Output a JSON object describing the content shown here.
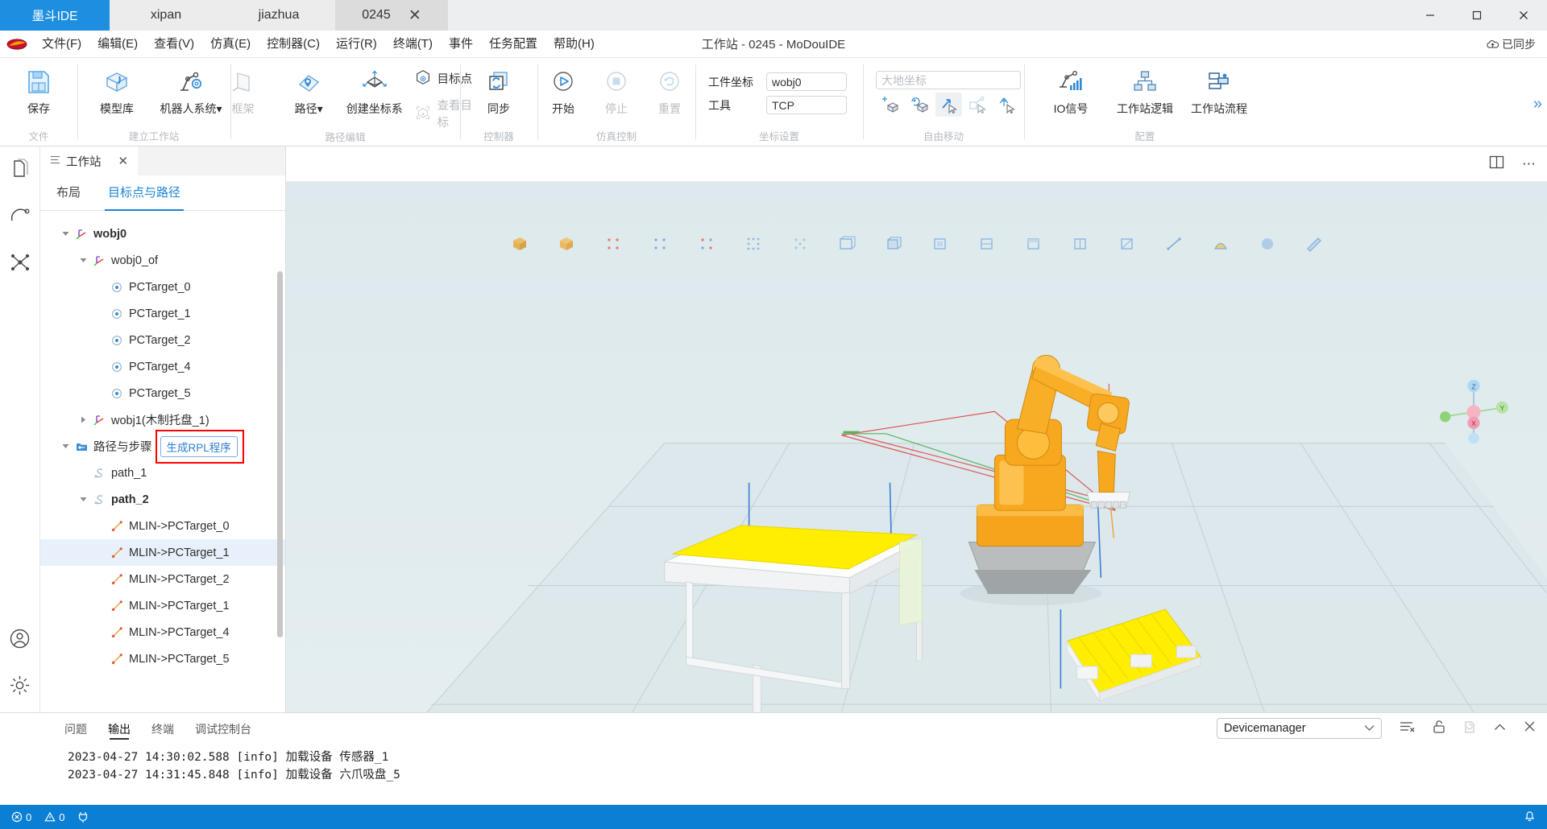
{
  "window": {
    "title": "工作站 - 0245 - MoDouIDE",
    "sync_label": "已同步",
    "minimize": "—",
    "maximize": "▢",
    "close": "✕"
  },
  "tabs": [
    {
      "label": "墨斗IDE",
      "type": "brand"
    },
    {
      "label": "xipan",
      "type": "plain"
    },
    {
      "label": "jiazhua",
      "type": "plain"
    },
    {
      "label": "0245",
      "type": "current",
      "close": "✕"
    }
  ],
  "menu": [
    "文件(F)",
    "编辑(E)",
    "查看(V)",
    "仿真(E)",
    "控制器(C)",
    "运行(R)",
    "终端(T)",
    "事件",
    "任务配置",
    "帮助(H)"
  ],
  "ribbon": {
    "expander": "»",
    "groups": [
      {
        "name": "文件",
        "buttons": [
          {
            "label": "保存",
            "icon": "save-icon",
            "disabled": false
          }
        ]
      },
      {
        "name": "建立工作站",
        "buttons": [
          {
            "label": "模型库",
            "icon": "model-library-icon",
            "disabled": false
          },
          {
            "label": "机器人系统▾",
            "icon": "robot-system-icon",
            "disabled": false
          }
        ]
      },
      {
        "name": "路径编辑",
        "buttons": [
          {
            "label": "框架",
            "icon": "frame-icon",
            "disabled": true
          },
          {
            "label": "路径▾",
            "icon": "path-icon",
            "disabled": false
          },
          {
            "label": "创建坐标系",
            "icon": "create-coordinate-icon",
            "disabled": false
          }
        ],
        "small_buttons": [
          {
            "label": "目标点",
            "icon": "target-point-icon",
            "disabled": false
          },
          {
            "label": "查看目标",
            "icon": "view-target-icon",
            "disabled": true
          }
        ]
      },
      {
        "name": "控制器",
        "buttons": [
          {
            "label": "同步",
            "icon": "sync-icon",
            "disabled": false
          }
        ]
      },
      {
        "name": "仿真控制",
        "buttons": [
          {
            "label": "开始",
            "icon": "play-icon",
            "disabled": false
          },
          {
            "label": "停止",
            "icon": "stop-icon",
            "disabled": true
          },
          {
            "label": "重置",
            "icon": "reset-icon",
            "disabled": true
          }
        ]
      },
      {
        "name": "坐标设置",
        "fields": [
          {
            "label": "工件坐标",
            "value": "wobj0"
          },
          {
            "label": "工具",
            "value": "TCP"
          }
        ]
      },
      {
        "name": "自由移动",
        "coord_placeholder": "大地坐标",
        "move_buttons": [
          {
            "icon": "translate-icon",
            "selected": false
          },
          {
            "icon": "rotate-icon",
            "selected": false
          },
          {
            "icon": "freemove-icon",
            "selected": true
          },
          {
            "icon": "align-icon",
            "selected": false
          },
          {
            "icon": "jog-icon",
            "selected": false
          }
        ]
      },
      {
        "name": "配置",
        "buttons": [
          {
            "label": "IO信号",
            "icon": "io-signal-icon",
            "disabled": false
          },
          {
            "label": "工作站逻辑",
            "icon": "station-logic-icon",
            "disabled": false
          },
          {
            "label": "工作站流程",
            "icon": "station-flow-icon",
            "disabled": false
          }
        ]
      }
    ]
  },
  "activity_bar": [
    {
      "icon": "files-icon",
      "name": "explorer"
    },
    {
      "icon": "robot-arc-icon",
      "name": "robot"
    },
    {
      "icon": "nodes-icon",
      "name": "nodes"
    },
    {
      "icon": "account-icon",
      "name": "account"
    },
    {
      "icon": "gear-icon",
      "name": "settings"
    }
  ],
  "left_panel": {
    "tab_label": "工作站",
    "tab_close": "✕",
    "subtabs": [
      {
        "label": "布局",
        "active": false
      },
      {
        "label": "目标点与路径",
        "active": true
      }
    ],
    "rpl_button": "生成RPL程序",
    "tree": [
      {
        "label": "wobj0",
        "indent": 1,
        "caret": "down",
        "icon": "coordinate-frame-icon",
        "bold": true
      },
      {
        "label": "wobj0_of",
        "indent": 2,
        "caret": "down",
        "icon": "coordinate-frame-icon",
        "bold": false
      },
      {
        "label": "PCTarget_0",
        "indent": 3,
        "caret": "none",
        "icon": "target-dot-icon",
        "bold": false
      },
      {
        "label": "PCTarget_1",
        "indent": 3,
        "caret": "none",
        "icon": "target-dot-icon",
        "bold": false
      },
      {
        "label": "PCTarget_2",
        "indent": 3,
        "caret": "none",
        "icon": "target-dot-icon",
        "bold": false
      },
      {
        "label": "PCTarget_4",
        "indent": 3,
        "caret": "none",
        "icon": "target-dot-icon",
        "bold": false
      },
      {
        "label": "PCTarget_5",
        "indent": 3,
        "caret": "none",
        "icon": "target-dot-icon",
        "bold": false
      },
      {
        "label": "wobj1(木制托盘_1)",
        "indent": 2,
        "caret": "right",
        "icon": "coordinate-frame-icon",
        "bold": false
      },
      {
        "label": "路径与步骤",
        "indent": 1,
        "caret": "down",
        "icon": "path-folder-icon",
        "bold": false,
        "has_rpl": true
      },
      {
        "label": "path_1",
        "indent": 2,
        "caret": "none",
        "icon": "path-s-icon",
        "bold": false
      },
      {
        "label": "path_2",
        "indent": 2,
        "caret": "down",
        "icon": "path-s-icon",
        "bold": true
      },
      {
        "label": "MLIN->PCTarget_0",
        "indent": 3,
        "caret": "none",
        "icon": "move-line-icon",
        "bold": false
      },
      {
        "label": "MLIN->PCTarget_1",
        "indent": 3,
        "caret": "none",
        "icon": "move-line-icon",
        "bold": false,
        "selected": true
      },
      {
        "label": "MLIN->PCTarget_2",
        "indent": 3,
        "caret": "none",
        "icon": "move-line-icon",
        "bold": false
      },
      {
        "label": "MLIN->PCTarget_1",
        "indent": 3,
        "caret": "none",
        "icon": "move-line-icon",
        "bold": false
      },
      {
        "label": "MLIN->PCTarget_4",
        "indent": 3,
        "caret": "none",
        "icon": "move-line-icon",
        "bold": false
      },
      {
        "label": "MLIN->PCTarget_5",
        "indent": 3,
        "caret": "none",
        "icon": "move-line-icon",
        "bold": false
      }
    ]
  },
  "viewport": {
    "split_icon": "split-editor-icon",
    "more_icon": "more-actions-icon",
    "gizmo": {
      "x": "X",
      "y": "Y",
      "z": "Z"
    },
    "toolbar_icons": [
      "box-solid-icon",
      "box-shaded-icon",
      "points-red-icon",
      "points-blue-icon",
      "points-mix-icon",
      "points-grid-icon",
      "points-dot-icon",
      "plane-icon",
      "cube-wire-icon",
      "cube-solid-icon",
      "cube-outline-icon",
      "cube-top-icon",
      "cube-side-icon",
      "cube-iso-icon",
      "cube-front-icon",
      "line-icon",
      "curve-icon",
      "sphere-icon",
      "measure-icon"
    ]
  },
  "console": {
    "tabs": [
      {
        "label": "问题",
        "active": false
      },
      {
        "label": "输出",
        "active": true
      },
      {
        "label": "终端",
        "active": false
      },
      {
        "label": "调试控制台",
        "active": false
      }
    ],
    "selector": {
      "value": "Devicemanager",
      "chevron": "⌄"
    },
    "actions": [
      {
        "icon": "clear-output-icon",
        "dim": false
      },
      {
        "icon": "unlock-icon",
        "dim": false
      },
      {
        "icon": "open-new-window-icon",
        "dim": true
      },
      {
        "icon": "chevron-up-icon",
        "dim": false
      },
      {
        "icon": "close-icon",
        "dim": false
      }
    ],
    "lines": [
      "2023-04-27 14:30:02.588 [info] 加载设备 传感器_1",
      "2023-04-27 14:31:45.848 [info] 加载设备 六爪吸盘_5"
    ]
  },
  "status_bar": {
    "errors": "0",
    "warnings": "0",
    "plug_icon": "plug-icon",
    "bell_icon": "bell-icon"
  },
  "colors": {
    "brand_blue": "#1e8fe0",
    "status_blue": "#0a7fd4",
    "accent": "#1b85d6",
    "highlight_red": "#fb0000",
    "robot_orange": "#f5a312",
    "pallet_yellow": "#ffee00"
  }
}
